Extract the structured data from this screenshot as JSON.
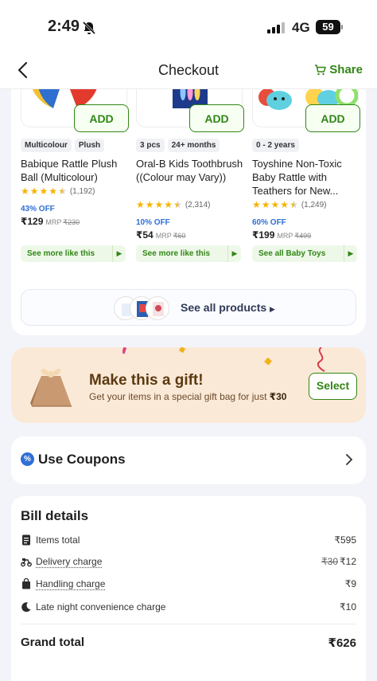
{
  "status": {
    "time": "2:49",
    "network": "4G",
    "battery": "59"
  },
  "header": {
    "title": "Checkout",
    "share_label": "Share"
  },
  "products": [
    {
      "add_label": "ADD",
      "tags": [
        "Multicolour",
        "Plush"
      ],
      "name": "Babique Rattle Plush Ball (Multicolour)",
      "rating_count": "(1,192)",
      "discount": "43% OFF",
      "price": "₹129",
      "mrp_label": "MRP",
      "mrp": "₹230",
      "see_more": "See more like this"
    },
    {
      "add_label": "ADD",
      "tags": [
        "3 pcs",
        "24+ months"
      ],
      "name": "Oral-B Kids Toothbrush ((Colour may Vary))",
      "rating_count": "(2,314)",
      "discount": "10% OFF",
      "price": "₹54",
      "mrp_label": "MRP",
      "mrp": "₹60",
      "see_more": "See more like this"
    },
    {
      "add_label": "ADD",
      "tags": [
        "0 - 2 years"
      ],
      "name": "Toyshine Non-Toxic Baby Rattle with Teathers for New...",
      "rating_count": "(1,249)",
      "discount": "60% OFF",
      "price": "₹199",
      "mrp_label": "MRP",
      "mrp": "₹499",
      "see_more": "See all Baby Toys"
    }
  ],
  "see_all": {
    "label": "See all products"
  },
  "gift": {
    "title": "Make this a gift!",
    "subtitle": "Get your items in a special gift bag for just ",
    "price": "₹30",
    "button": "Select"
  },
  "coupons": {
    "label": "Use Coupons",
    "icon": "%"
  },
  "bill": {
    "title": "Bill details",
    "rows": [
      {
        "label": "Items total",
        "value": "₹595",
        "strike": ""
      },
      {
        "label": "Delivery charge",
        "value": "₹12",
        "strike": "₹30"
      },
      {
        "label": "Handling charge",
        "value": "₹9",
        "strike": ""
      },
      {
        "label": "Late night convenience charge",
        "value": "₹10",
        "strike": ""
      }
    ],
    "grand_label": "Grand total",
    "grand_value": "₹626"
  },
  "colors": {
    "accent_green": "#318616",
    "discount_blue": "#2f6fd6",
    "gift_bg": "#fbe9d7"
  }
}
